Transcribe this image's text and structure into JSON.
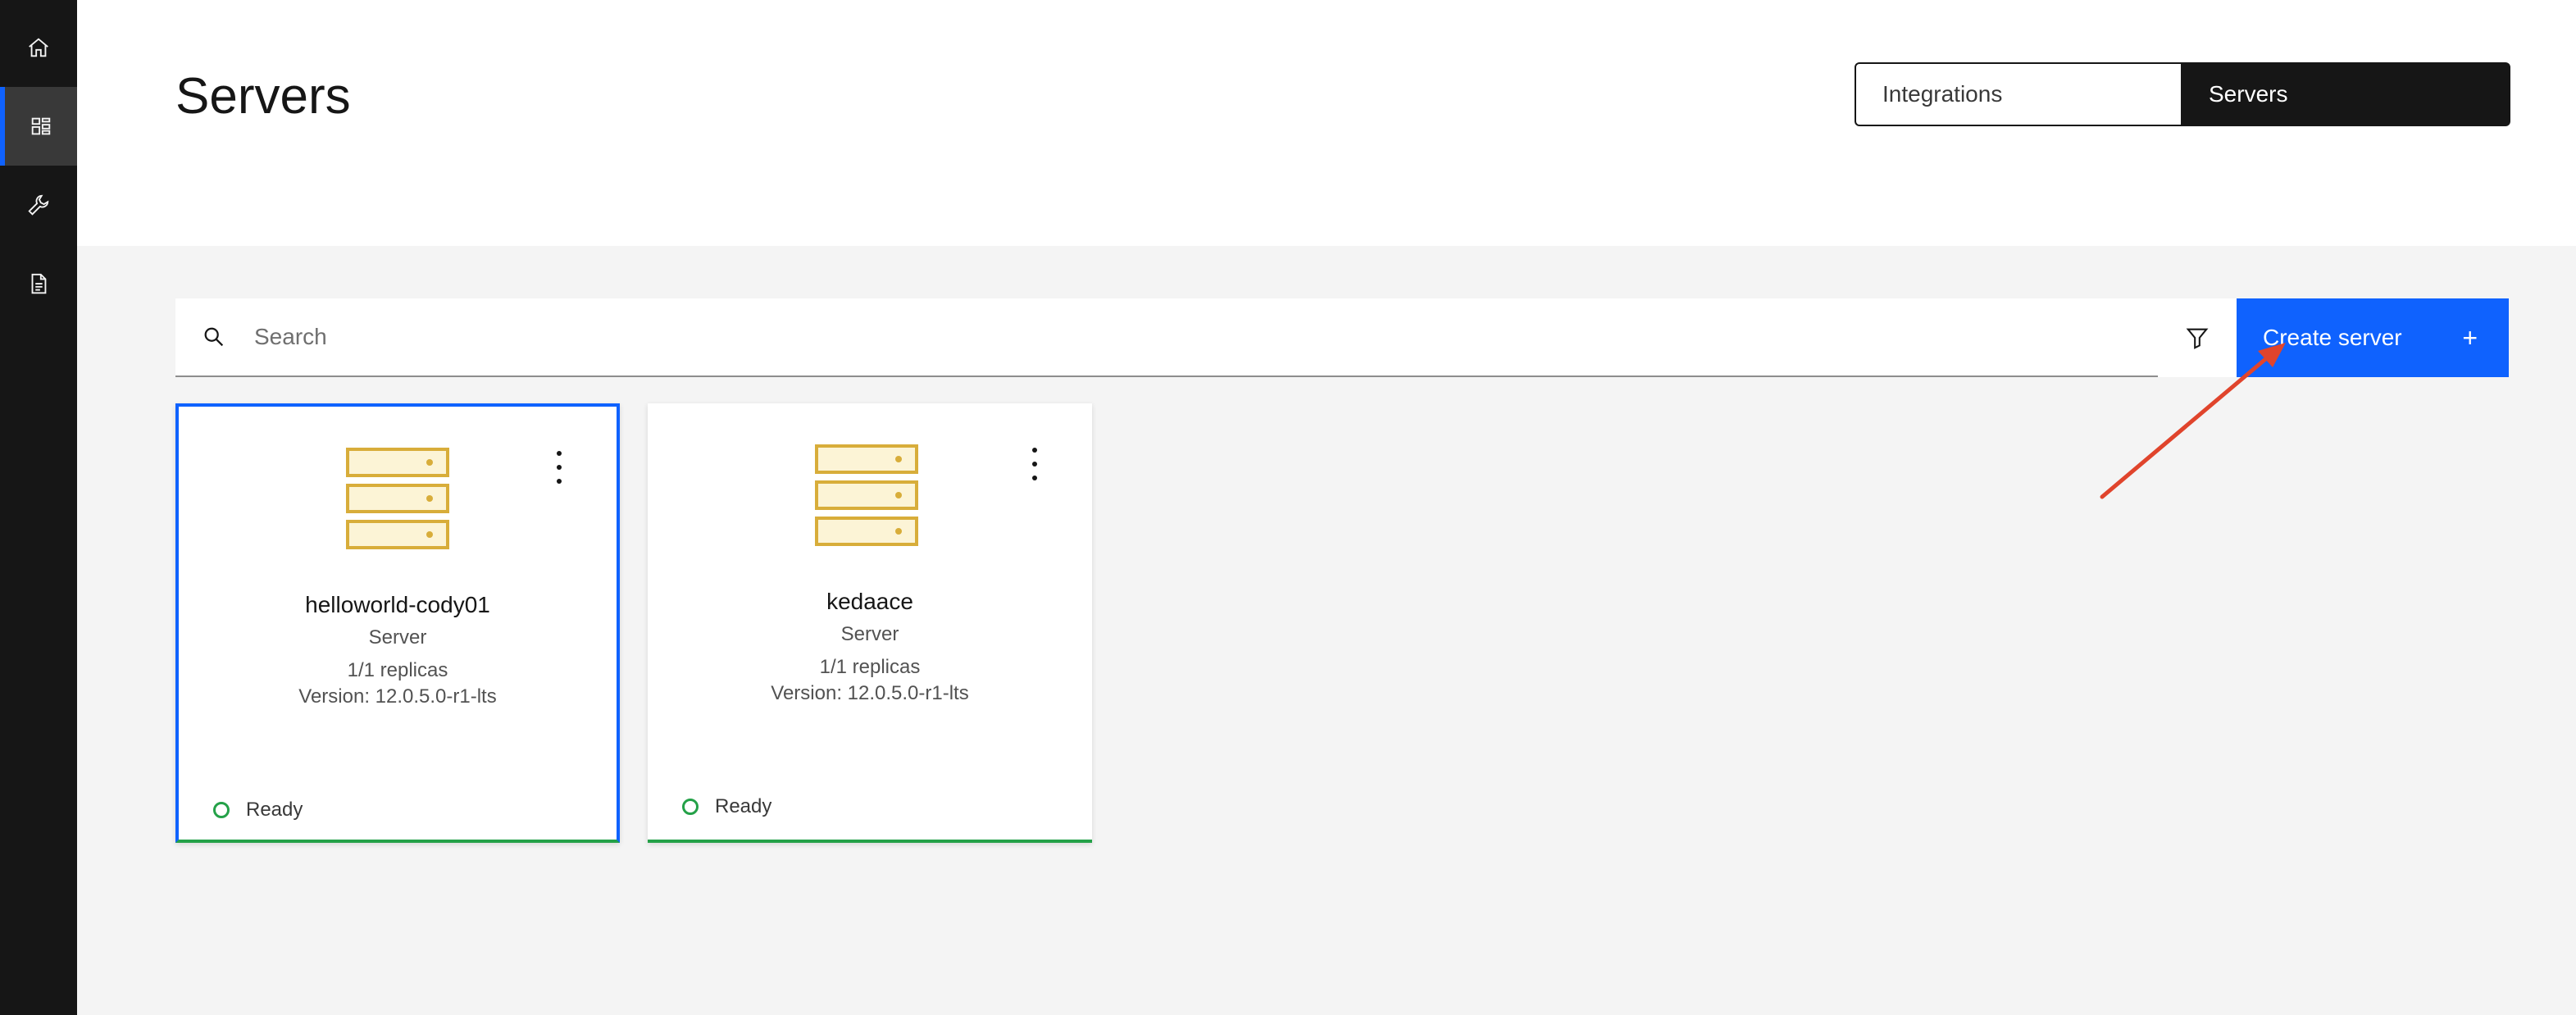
{
  "rail": {
    "items": [
      {
        "name": "home",
        "icon": "home-icon"
      },
      {
        "name": "dashboard",
        "icon": "dashboard-icon",
        "active": true
      },
      {
        "name": "tools",
        "icon": "wrench-icon"
      },
      {
        "name": "documents",
        "icon": "document-icon"
      }
    ]
  },
  "header": {
    "title": "Servers",
    "switcher": {
      "integrations_label": "Integrations",
      "servers_label": "Servers",
      "selected": "Servers"
    }
  },
  "toolbar": {
    "search_placeholder": "Search",
    "create_label": "Create server",
    "create_plus": "+"
  },
  "cards": [
    {
      "name": "helloworld-cody01",
      "type": "Server",
      "replicas": "1/1 replicas",
      "version": "Version: 12.0.5.0-r1-lts",
      "status": "Ready"
    },
    {
      "name": "kedaace",
      "type": "Server",
      "replicas": "1/1 replicas",
      "version": "Version: 12.0.5.0-r1-lts",
      "status": "Ready"
    }
  ],
  "colors": {
    "accent": "#0f62fe",
    "rail_bg": "#161616",
    "status_ready": "#24a148",
    "server_icon": "#d8ad3a",
    "annotation_arrow": "#e0442c"
  }
}
